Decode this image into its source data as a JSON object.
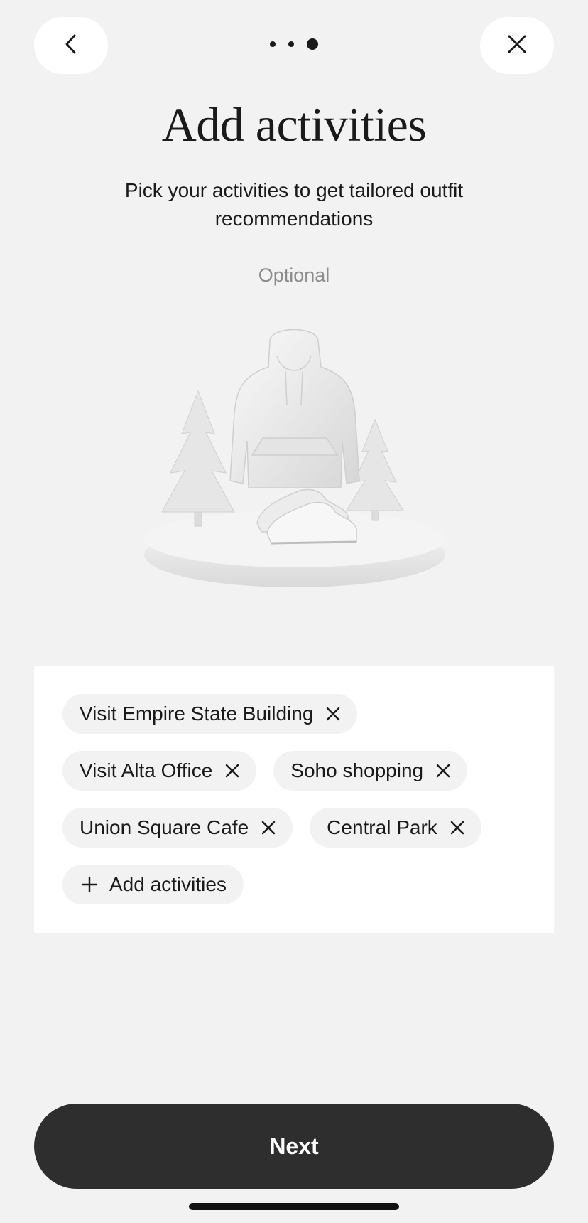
{
  "header": {
    "back_icon": "chevron-left-icon",
    "close_icon": "close-icon",
    "progress": {
      "steps": 3,
      "current": 3
    }
  },
  "main": {
    "title": "Add activities",
    "subtitle": "Pick your activities to get tailored outfit recommendations",
    "optional_label": "Optional",
    "illustration": "hoodie-sneakers-trees-illustration"
  },
  "activities": {
    "chips": [
      {
        "label": "Visit Empire State Building",
        "icon": "close-icon"
      },
      {
        "label": "Visit Alta Office",
        "icon": "close-icon"
      },
      {
        "label": "Soho shopping",
        "icon": "close-icon"
      },
      {
        "label": "Union Square Cafe",
        "icon": "close-icon"
      },
      {
        "label": "Central Park",
        "icon": "close-icon"
      }
    ],
    "add_label": "Add activities",
    "add_icon": "plus-icon"
  },
  "footer": {
    "next_label": "Next"
  },
  "colors": {
    "background": "#f2f2f2",
    "panel": "#ffffff",
    "primary_button": "#2e2e2e",
    "muted_text": "#8c8c8c"
  }
}
